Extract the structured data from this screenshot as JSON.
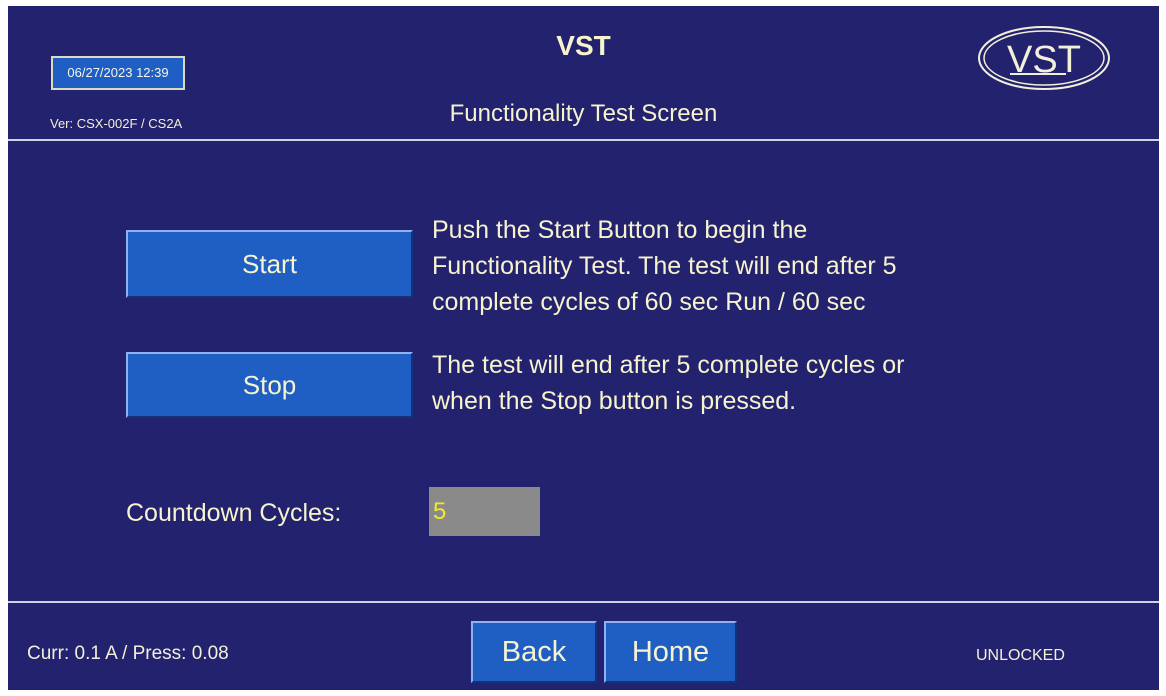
{
  "header": {
    "datetime": "06/27/2023 12:39",
    "version": "Ver: CSX-002F / CS2A",
    "app_title": "VST",
    "screen_title": "Functionality Test Screen",
    "logo_text": "VST",
    "logo_icon": "vst-logo-icon"
  },
  "controls": {
    "start_label": "Start",
    "stop_label": "Stop"
  },
  "instructions": {
    "start_lines": [
      "Push the Start Button to begin the",
      "Functionality Test. The test will end after 5",
      "complete cycles of 60 sec Run / 60 sec"
    ],
    "stop_lines": [
      "The test will end after 5 complete cycles or",
      "when the Stop button is pressed."
    ]
  },
  "countdown": {
    "label": "Countdown Cycles:",
    "value": "5"
  },
  "footer": {
    "status": "Curr: 0.1 A / Press: 0.08",
    "back_label": "Back",
    "home_label": "Home",
    "lock_status": "UNLOCKED"
  },
  "colors": {
    "background": "#23226e",
    "button": "#1f5fc4",
    "text": "#f7f3cf",
    "countdown_field": "#8a8a8a",
    "countdown_value": "#f2e82b"
  }
}
